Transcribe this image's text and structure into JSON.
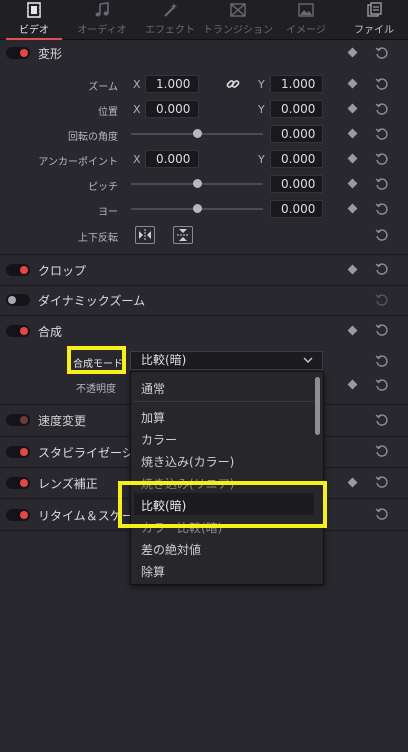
{
  "tabs": [
    {
      "label": "ビデオ",
      "icon": "film-icon",
      "active": true
    },
    {
      "label": "オーディオ",
      "icon": "music-note-icon",
      "active": false
    },
    {
      "label": "エフェクト",
      "icon": "wand-icon",
      "active": false
    },
    {
      "label": "トランジション",
      "icon": "transition-icon",
      "active": false
    },
    {
      "label": "イメージ",
      "icon": "image-icon",
      "active": false
    },
    {
      "label": "ファイル",
      "icon": "file-icon",
      "active": false
    }
  ],
  "transform": {
    "title": "変形",
    "zoom": {
      "label": "ズーム",
      "x_axis": "X",
      "x": "1.000",
      "y_axis": "Y",
      "y": "1.000"
    },
    "position": {
      "label": "位置",
      "x_axis": "X",
      "x": "0.000",
      "y_axis": "Y",
      "y": "0.000"
    },
    "rotation": {
      "label": "回転の角度",
      "value": "0.000"
    },
    "anchor": {
      "label": "アンカーポイント",
      "x_axis": "X",
      "x": "0.000",
      "y_axis": "Y",
      "y": "0.000"
    },
    "pitch": {
      "label": "ピッチ",
      "value": "0.000"
    },
    "yaw": {
      "label": "ヨー",
      "value": "0.000"
    },
    "flip": {
      "label": "上下反転"
    }
  },
  "sections": {
    "crop": "クロップ",
    "dynamic_zoom": "ダイナミックズーム",
    "composite": "合成",
    "speed": "速度変更",
    "stabilization": "スタビライゼーション",
    "lens": "レンズ補正",
    "retime": "リタイム＆スケーリング"
  },
  "composite": {
    "mode_label": "合成モード",
    "mode_value": "比較(暗)",
    "opacity_label": "不透明度"
  },
  "dropdown": {
    "items": [
      "通常",
      "加算",
      "カラー",
      "焼き込み(カラー)",
      "焼き込み(リニア)",
      "比較(暗)",
      "カラー比較(暗)",
      "差の絶対値",
      "除算"
    ],
    "selected": "比較(暗)"
  },
  "colors": {
    "accent": "#e84545",
    "highlight": "#f5f019",
    "background": "#28282e"
  }
}
